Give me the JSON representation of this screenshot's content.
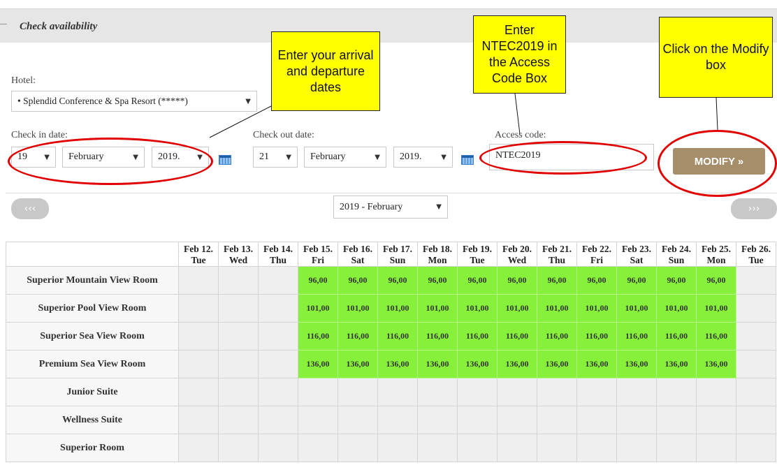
{
  "panel": {
    "title": "Check availability"
  },
  "hotel": {
    "label": "Hotel:",
    "value": "• Splendid Conference & Spa Resort (*****)"
  },
  "checkin": {
    "label": "Check in date:",
    "day": "19",
    "month": "February",
    "year": "2019."
  },
  "checkout": {
    "label": "Check out date:",
    "day": "21",
    "month": "February",
    "year": "2019."
  },
  "access": {
    "label": "Access code:",
    "value": "NTEC2019"
  },
  "modify_label": "MODIFY »",
  "callouts": {
    "dates": "Enter your arrival and departure dates",
    "code": "Enter NTEC2019 in the Access Code Box",
    "modify": "Click on the Modify box"
  },
  "calendar": {
    "prev": "‹‹‹",
    "next": "›››",
    "month_select": "2019 - February",
    "days": [
      {
        "date": "Feb 12.",
        "dow": "Tue"
      },
      {
        "date": "Feb 13.",
        "dow": "Wed"
      },
      {
        "date": "Feb 14.",
        "dow": "Thu"
      },
      {
        "date": "Feb 15.",
        "dow": "Fri"
      },
      {
        "date": "Feb 16.",
        "dow": "Sat"
      },
      {
        "date": "Feb 17.",
        "dow": "Sun"
      },
      {
        "date": "Feb 18.",
        "dow": "Mon"
      },
      {
        "date": "Feb 19.",
        "dow": "Tue"
      },
      {
        "date": "Feb 20.",
        "dow": "Wed"
      },
      {
        "date": "Feb 21.",
        "dow": "Thu"
      },
      {
        "date": "Feb 22.",
        "dow": "Fri"
      },
      {
        "date": "Feb 23.",
        "dow": "Sat"
      },
      {
        "date": "Feb 24.",
        "dow": "Sun"
      },
      {
        "date": "Feb 25.",
        "dow": "Mon"
      },
      {
        "date": "Feb 26.",
        "dow": "Tue"
      }
    ],
    "rooms": [
      {
        "name": "Superior Mountain View Room",
        "price": "96,00",
        "avail": [
          false,
          false,
          false,
          true,
          true,
          true,
          true,
          true,
          true,
          true,
          true,
          true,
          true,
          true,
          false
        ]
      },
      {
        "name": "Superior Pool View Room",
        "price": "101,00",
        "avail": [
          false,
          false,
          false,
          true,
          true,
          true,
          true,
          true,
          true,
          true,
          true,
          true,
          true,
          true,
          false
        ]
      },
      {
        "name": "Superior Sea View Room",
        "price": "116,00",
        "avail": [
          false,
          false,
          false,
          true,
          true,
          true,
          true,
          true,
          true,
          true,
          true,
          true,
          true,
          true,
          false
        ]
      },
      {
        "name": "Premium Sea View Room",
        "price": "136,00",
        "avail": [
          false,
          false,
          false,
          true,
          true,
          true,
          true,
          true,
          true,
          true,
          true,
          true,
          true,
          true,
          false
        ]
      },
      {
        "name": "Junior Suite",
        "price": "",
        "avail": [
          false,
          false,
          false,
          false,
          false,
          false,
          false,
          false,
          false,
          false,
          false,
          false,
          false,
          false,
          false
        ]
      },
      {
        "name": "Wellness Suite",
        "price": "",
        "avail": [
          false,
          false,
          false,
          false,
          false,
          false,
          false,
          false,
          false,
          false,
          false,
          false,
          false,
          false,
          false
        ]
      },
      {
        "name": "Superior Room",
        "price": "",
        "avail": [
          false,
          false,
          false,
          false,
          false,
          false,
          false,
          false,
          false,
          false,
          false,
          false,
          false,
          false,
          false
        ]
      }
    ]
  },
  "colors": {
    "available": "#86f03a",
    "callout": "#ffff00",
    "annotation": "#e00000",
    "modify_button": "#a68e6b"
  }
}
